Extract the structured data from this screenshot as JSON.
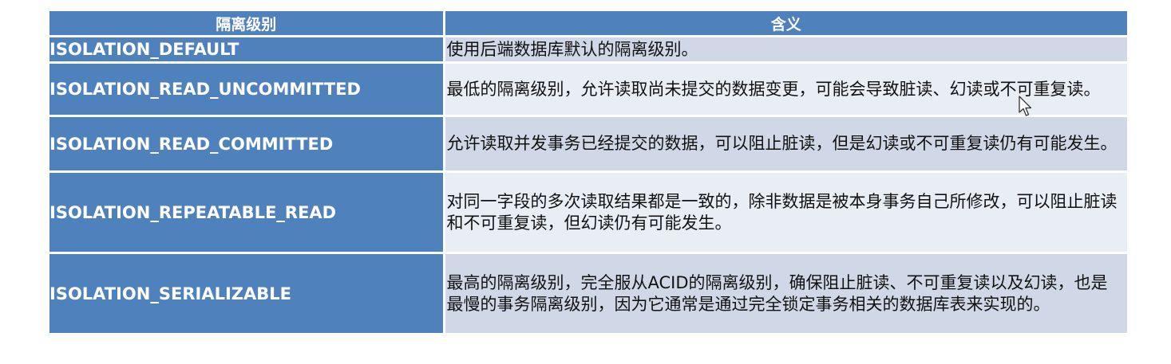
{
  "table": {
    "headers": [
      "隔离级别",
      "含义"
    ],
    "rows": [
      {
        "level": "ISOLATION_DEFAULT",
        "meaning": "使用后端数据库默认的隔离级别。"
      },
      {
        "level": "ISOLATION_READ_UNCOMMITTED",
        "meaning": "最低的隔离级别，允许读取尚未提交的数据变更，可能会导致脏读、幻读或不可重复读。"
      },
      {
        "level": "ISOLATION_READ_COMMITTED",
        "meaning": "允许读取并发事务已经提交的数据，可以阻止脏读，但是幻读或不可重复读仍有可能发生。"
      },
      {
        "level": "ISOLATION_REPEATABLE_READ",
        "meaning": "对同一字段的多次读取结果都是一致的，除非数据是被本身事务自己所修改，可以阻止脏读和不可重复读，但幻读仍有可能发生。"
      },
      {
        "level": "ISOLATION_SERIALIZABLE",
        "meaning": "最高的隔离级别，完全服从ACID的隔离级别，确保阻止脏读、不可重复读以及幻读，也是最慢的事务隔离级别，因为它通常是通过完全锁定事务相关的数据库表来实现的。"
      }
    ]
  },
  "colors": {
    "header_bg": "#4f81bd",
    "row_odd": "#d0d8e8",
    "row_even": "#e9edf4"
  },
  "icons": {
    "cursor": "mouse-pointer-icon"
  }
}
